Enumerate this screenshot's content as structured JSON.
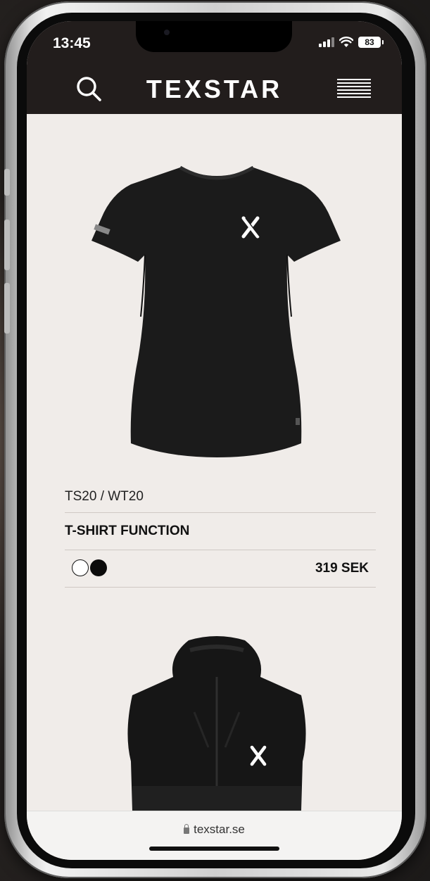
{
  "status_bar": {
    "time": "13:45",
    "battery": "83"
  },
  "header": {
    "brand": "TEXSTAR",
    "search_icon": "search-icon",
    "menu_icon": "hamburger-menu-icon"
  },
  "products": [
    {
      "sku": "TS20 / WT20",
      "name": "T-SHIRT FUNCTION",
      "price": "319 SEK",
      "swatches": [
        "#ffffff",
        "#0b0b0b"
      ]
    }
  ],
  "browser": {
    "url": "texstar.se"
  },
  "colors": {
    "header_bg": "#221d1c",
    "page_bg": "#f0ece9",
    "divider": "#cfc9c4"
  }
}
